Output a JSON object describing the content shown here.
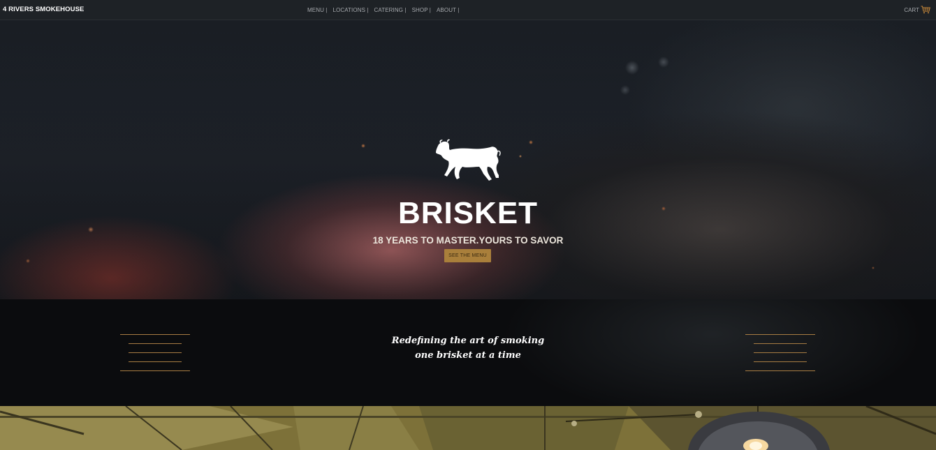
{
  "nav": {
    "brand": "4 RIVERS SMOKEHOUSE",
    "links": [
      "MENU |",
      "LOCATIONS |",
      "CATERING |",
      "SHOP |",
      "ABOUT |"
    ],
    "cart_label": "CART",
    "cart_icon": "cart-icon"
  },
  "hero": {
    "logo_icon": "bull-icon",
    "title": "BRISKET",
    "subtitle": "18 YEARS TO MASTER.YOURS TO SAVOR",
    "button_label": "SEE THE MENU"
  },
  "tagline": {
    "line1": "Redefining the art of smoking",
    "line2": "one brisket at a time"
  },
  "colors": {
    "accent": "#a97f3b",
    "navbar_bg": "#1e2226",
    "band_bg": "#0b0c0e"
  }
}
